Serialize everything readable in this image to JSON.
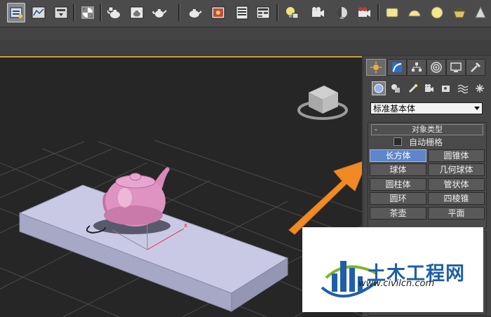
{
  "toolbar": {
    "icons": [
      "select-and-link-icon",
      "track-view-icon",
      "schematic-view-icon",
      "material-editor-icon",
      "render-setup-icon",
      "rendered-frame-icon",
      "render-icon",
      "teapot-render-icon",
      "environment-icon",
      "effects-icon",
      "list-icon",
      "layer-icon",
      "light-bulb-icon",
      "camera-icon",
      "sky-icon",
      "video-camera-icon",
      "plane-icon",
      "hemisphere-icon",
      "sphere-icon",
      "basket-icon",
      "cone-icon"
    ]
  },
  "panel": {
    "tabs": [
      "create-tab",
      "modify-tab",
      "hierarchy-tab",
      "motion-tab",
      "display-tab",
      "utilities-tab"
    ],
    "subcategories": [
      "geometry-icon",
      "shapes-icon",
      "lights-icon",
      "cameras-icon",
      "helpers-icon",
      "space-warps-icon",
      "systems-icon"
    ],
    "dropdown": {
      "value": "标准基本体"
    },
    "rollout": {
      "collapse_symbol": "-",
      "title": "对象类型",
      "autogrid_label": "自动栅格",
      "autogrid_checked": false,
      "buttons": [
        {
          "label": "长方体",
          "active": true
        },
        {
          "label": "圆锥体",
          "active": false
        },
        {
          "label": "球体",
          "active": false
        },
        {
          "label": "几何球体",
          "active": false
        },
        {
          "label": "圆柱体",
          "active": false
        },
        {
          "label": "管状体",
          "active": false
        },
        {
          "label": "圆环",
          "active": false
        },
        {
          "label": "四棱锥",
          "active": false
        },
        {
          "label": "茶壶",
          "active": false
        },
        {
          "label": "平面",
          "active": false
        }
      ]
    }
  },
  "viewport": {
    "colors": {
      "box": "#b8b8d8",
      "teapot": "#d889b8",
      "arrow": "#f08a24",
      "background": "#262626"
    }
  },
  "watermark": {
    "title": "土木工程网",
    "url": "www.civilcn.com"
  },
  "colors": {
    "accent": "#5e86c8",
    "viewport_border": "#c7a33a"
  }
}
